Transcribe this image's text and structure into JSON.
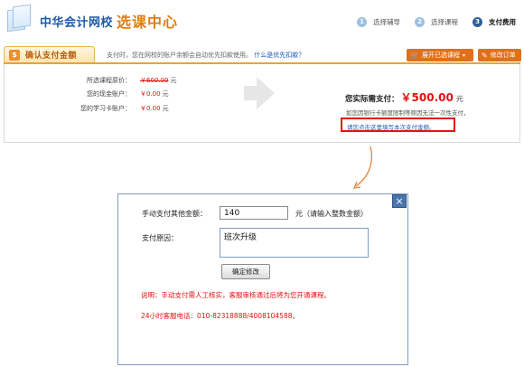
{
  "header": {
    "site_name": "中华会计网校",
    "page_title": "选课中心",
    "steps": [
      {
        "num": "1",
        "label": "选择辅导"
      },
      {
        "num": "2",
        "label": "选择课程"
      },
      {
        "num": "3",
        "label": "支付费用"
      }
    ],
    "active_step": 3
  },
  "confirm_bar": {
    "tab_icon": "$",
    "tab_label": "确认支付金额",
    "note": "支付时，您在网校的账户余额会自动优先扣款使用。",
    "note_link": "什么是优先扣款？",
    "expand_button": "展开已选课程",
    "edit_order_button": "修改订单"
  },
  "payment": {
    "rows": [
      {
        "label": "所选课程原价：",
        "value": "￥600.00",
        "unit": "元",
        "strike": true
      },
      {
        "label": "您的现金账户：",
        "value": "￥0.00",
        "unit": "元",
        "strike": false
      },
      {
        "label": "您的学习卡账户：",
        "value": "￥0.00",
        "unit": "元",
        "strike": false
      }
    ],
    "actual_label": "您实际需支付：",
    "actual_value": "￥500.00",
    "actual_unit": "元",
    "tip": "如您因银行卡额度限制等原因无法一次性支付，",
    "manual_link": "请您点击这里填写本次支付金额。"
  },
  "modal": {
    "close_icon": "×",
    "amount_label": "手动支付其他金额：",
    "amount_value": "140",
    "amount_unit": "元（请输入整数金额）",
    "reason_label": "支付原因：",
    "reason_value": "班次升级",
    "confirm_button": "确定修改",
    "note": "说明：手动支付需人工核实，客服审核通过后将为您开通课程。",
    "hotline": "24小时客服电话：010-82318888/4008104588。"
  },
  "colors": {
    "brand_blue": "#1c5aa8",
    "title_orange": "#e07d10",
    "money_red": "#e01010",
    "button_orange": "#e0701c",
    "highlight_red": "#e01515"
  }
}
